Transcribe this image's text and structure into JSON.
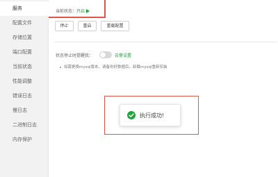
{
  "sidebar": {
    "items": [
      {
        "label": "服务",
        "active": true
      },
      {
        "label": "配置文件",
        "active": false
      },
      {
        "label": "存储位置",
        "active": false
      },
      {
        "label": "端口配置",
        "active": false
      },
      {
        "label": "当前状态",
        "active": false
      },
      {
        "label": "性能调整",
        "active": false
      },
      {
        "label": "错误日志",
        "active": false
      },
      {
        "label": "慢日志",
        "active": false
      },
      {
        "label": "二进制日志",
        "active": false
      },
      {
        "label": "内存保护",
        "active": false
      }
    ]
  },
  "main": {
    "status_label": "当前状态：",
    "status_value": "开启",
    "status_icon": "play-icon",
    "buttons": {
      "stop": "停止",
      "restart": "重启",
      "reload": "重载配置"
    },
    "alert_label": "状态停止时提醒我：",
    "alert_toggle_on": false,
    "alert_link": "告警设置",
    "tip": "如需更换mysql版本，请备份好数据后，卸载mysql重新安装"
  },
  "toast": {
    "icon": "check-circle-icon",
    "message": "执行成功!"
  },
  "colors": {
    "accent": "#20a53a",
    "highlight_border": "#e0554a",
    "sidebar_bg": "#f2f2f2"
  }
}
